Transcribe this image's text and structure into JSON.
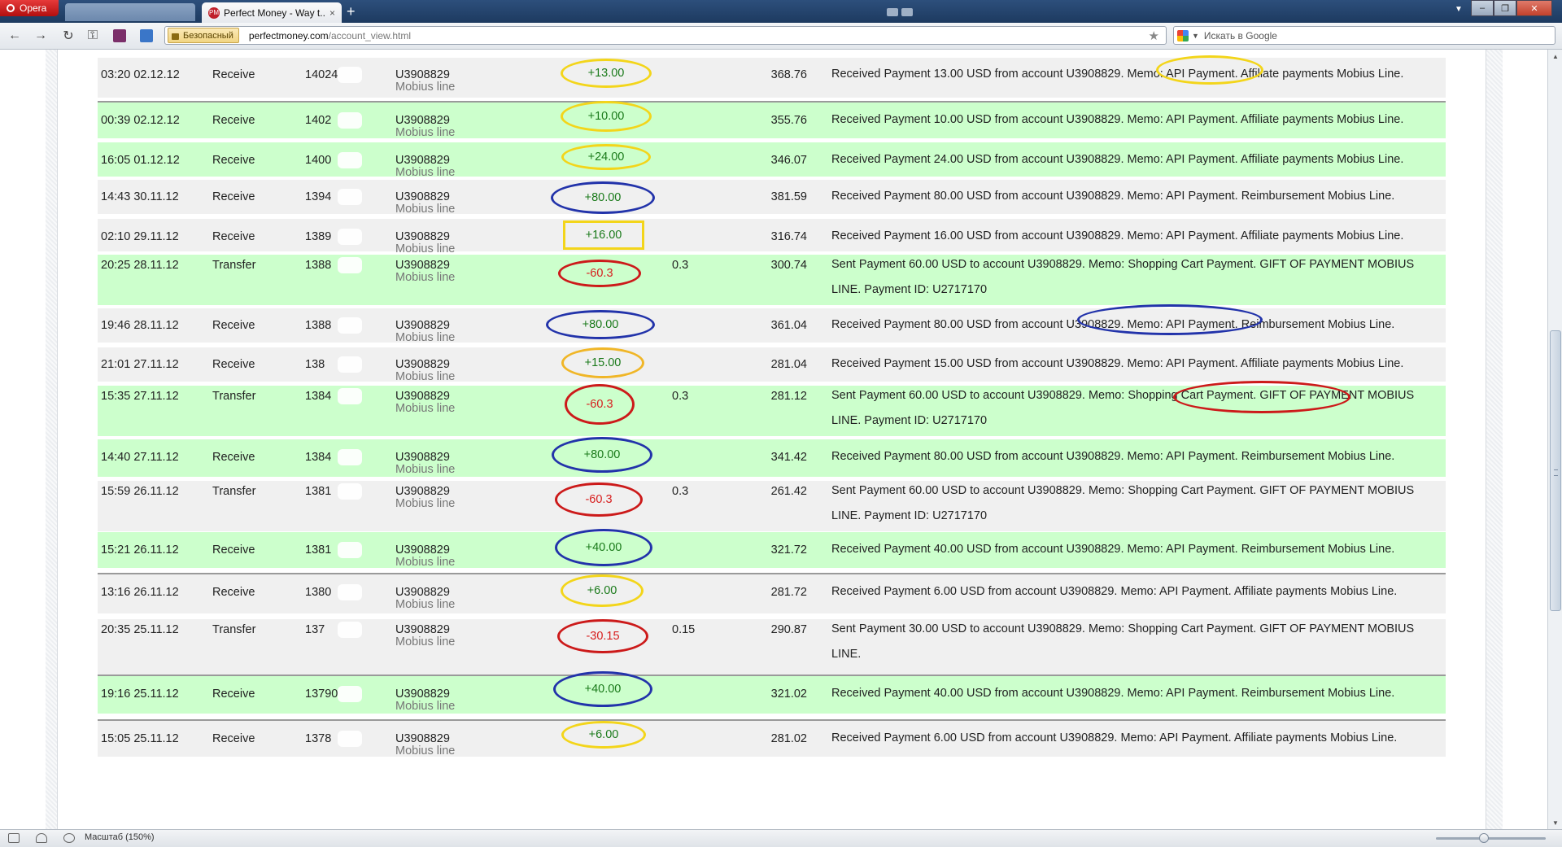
{
  "browser": {
    "opera_label": "Opera",
    "tab_title": "Perfect Money - Way t...",
    "tab_favicon": "PM",
    "tab_close": "×",
    "new_tab": "+",
    "security_label": "Безопасный",
    "url_host": "perfectmoney.com",
    "url_path": "/account_view.html",
    "search_placeholder": "Искать в Google",
    "status_zoom": "Масштаб (150%)"
  },
  "colors": {
    "row_green": "#ccffcc",
    "row_grey": "#f0f0f0",
    "amount_positive": "#1a7a1a",
    "amount_negative": "#d71d1d",
    "highlight_yellow": "#f3d51a",
    "highlight_blue": "#2233aa",
    "highlight_red": "#cc1a1a",
    "highlight_orange": "#f0b627"
  },
  "transactions": [
    {
      "date": "03:20 02.12.12",
      "type": "Receive",
      "batch": "14024",
      "account": "U3908829",
      "account_name": "Mobius line",
      "amount": "+13.00",
      "fee": "",
      "balance": "368.76",
      "memo": "Received Payment 13.00 USD from account U3908829. Memo: API Payment. Affiliate payments Mobius Line."
    },
    {
      "date": "00:39 02.12.12",
      "type": "Receive",
      "batch": "1402",
      "account": "U3908829",
      "account_name": "Mobius line",
      "amount": "+10.00",
      "fee": "",
      "balance": "355.76",
      "memo": "Received Payment 10.00 USD from account U3908829. Memo: API Payment. Affiliate payments Mobius Line."
    },
    {
      "date": "16:05 01.12.12",
      "type": "Receive",
      "batch": "1400",
      "account": "U3908829",
      "account_name": "Mobius line",
      "amount": "+24.00",
      "fee": "",
      "balance": "346.07",
      "memo": "Received Payment 24.00 USD from account U3908829. Memo: API Payment. Affiliate payments Mobius Line."
    },
    {
      "date": "14:43 30.11.12",
      "type": "Receive",
      "batch": "1394",
      "account": "U3908829",
      "account_name": "Mobius line",
      "amount": "+80.00",
      "fee": "",
      "balance": "381.59",
      "memo": "Received Payment 80.00 USD from account U3908829. Memo: API Payment. Reimbursement Mobius Line."
    },
    {
      "date": "02:10 29.11.12",
      "type": "Receive",
      "batch": "1389",
      "account": "U3908829",
      "account_name": "Mobius line",
      "amount": "+16.00",
      "fee": "",
      "balance": "316.74",
      "memo": "Received Payment 16.00 USD from account U3908829. Memo: API Payment. Affiliate payments Mobius Line."
    },
    {
      "date": "20:25 28.11.12",
      "type": "Transfer",
      "batch": "1388",
      "account": "U3908829",
      "account_name": "Mobius line",
      "amount": "-60.3",
      "fee": "0.3",
      "balance": "300.74",
      "memo": "Sent Payment 60.00 USD to account U3908829. Memo: Shopping Cart Payment. GIFT OF PAYMENT MOBIUS LINE. Payment ID: U2717170"
    },
    {
      "date": "19:46 28.11.12",
      "type": "Receive",
      "batch": "1388",
      "account": "U3908829",
      "account_name": "Mobius line",
      "amount": "+80.00",
      "fee": "",
      "balance": "361.04",
      "memo": "Received Payment 80.00 USD from account U3908829. Memo: API Payment. Reimbursement Mobius Line."
    },
    {
      "date": "21:01 27.11.12",
      "type": "Receive",
      "batch": "138",
      "account": "U3908829",
      "account_name": "Mobius line",
      "amount": "+15.00",
      "fee": "",
      "balance": "281.04",
      "memo": "Received Payment 15.00 USD from account U3908829. Memo: API Payment. Affiliate payments Mobius Line."
    },
    {
      "date": "15:35 27.11.12",
      "type": "Transfer",
      "batch": "1384",
      "account": "U3908829",
      "account_name": "Mobius line",
      "amount": "-60.3",
      "fee": "0.3",
      "balance": "281.12",
      "memo": "Sent Payment 60.00 USD to account U3908829. Memo: Shopping Cart Payment. GIFT OF PAYMENT MOBIUS LINE. Payment ID: U2717170"
    },
    {
      "date": "14:40 27.11.12",
      "type": "Receive",
      "batch": "1384",
      "account": "U3908829",
      "account_name": "Mobius line",
      "amount": "+80.00",
      "fee": "",
      "balance": "341.42",
      "memo": "Received Payment 80.00 USD from account U3908829. Memo: API Payment. Reimbursement Mobius Line."
    },
    {
      "date": "15:59 26.11.12",
      "type": "Transfer",
      "batch": "1381",
      "account": "U3908829",
      "account_name": "Mobius line",
      "amount": "-60.3",
      "fee": "0.3",
      "balance": "261.42",
      "memo": "Sent Payment 60.00 USD to account U3908829. Memo: Shopping Cart Payment. GIFT OF PAYMENT MOBIUS LINE. Payment ID: U2717170"
    },
    {
      "date": "15:21 26.11.12",
      "type": "Receive",
      "batch": "1381",
      "account": "U3908829",
      "account_name": "Mobius line",
      "amount": "+40.00",
      "fee": "",
      "balance": "321.72",
      "memo": "Received Payment 40.00 USD from account U3908829. Memo: API Payment. Reimbursement Mobius Line."
    },
    {
      "date": "13:16 26.11.12",
      "type": "Receive",
      "batch": "1380",
      "account": "U3908829",
      "account_name": "Mobius line",
      "amount": "+6.00",
      "fee": "",
      "balance": "281.72",
      "memo": "Received Payment 6.00 USD from account U3908829. Memo: API Payment. Affiliate payments Mobius Line."
    },
    {
      "date": "20:35 25.11.12",
      "type": "Transfer",
      "batch": "137",
      "account": "U3908829",
      "account_name": "Mobius line",
      "amount": "-30.15",
      "fee": "0.15",
      "balance": "290.87",
      "memo": "Sent Payment 30.00 USD to account U3908829. Memo: Shopping Cart Payment. GIFT OF PAYMENT MOBIUS LINE."
    },
    {
      "date": "19:16 25.11.12",
      "type": "Receive",
      "batch": "13790",
      "account": "U3908829",
      "account_name": "Mobius line",
      "amount": "+40.00",
      "fee": "",
      "balance": "321.02",
      "memo": "Received Payment 40.00 USD from account U3908829. Memo: API Payment. Reimbursement Mobius Line."
    },
    {
      "date": "15:05 25.11.12",
      "type": "Receive",
      "batch": "1378",
      "account": "U3908829",
      "account_name": "Mobius line",
      "amount": "+6.00",
      "fee": "",
      "balance": "281.02",
      "memo": "Received Payment 6.00 USD from account U3908829. Memo: API Payment. Affiliate payments Mobius Line."
    }
  ]
}
